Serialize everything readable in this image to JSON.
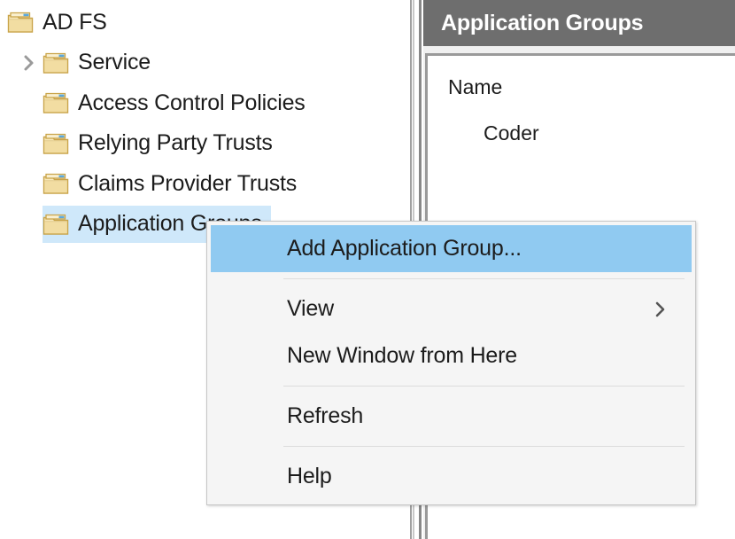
{
  "tree": {
    "items": [
      {
        "label": "AD FS",
        "level": 0,
        "icon": "folder-icon",
        "expander": "none",
        "selected": false
      },
      {
        "label": "Service",
        "level": 1,
        "icon": "folder-icon",
        "expander": "collapsed",
        "selected": false
      },
      {
        "label": "Access Control Policies",
        "level": 1,
        "icon": "folder-icon",
        "expander": "none",
        "selected": false
      },
      {
        "label": "Relying Party Trusts",
        "level": 1,
        "icon": "folder-icon",
        "expander": "none",
        "selected": false
      },
      {
        "label": "Claims Provider Trusts",
        "level": 1,
        "icon": "folder-icon",
        "expander": "none",
        "selected": false
      },
      {
        "label": "Application Groups",
        "level": 1,
        "icon": "folder-icon",
        "expander": "none",
        "selected": true
      }
    ]
  },
  "results": {
    "header_title": "Application Groups",
    "column_header": "Name",
    "rows": [
      {
        "name": "Coder"
      }
    ]
  },
  "context_menu": {
    "items": [
      {
        "label": "Add Application Group...",
        "highlighted": true,
        "submenu": false,
        "separator_after": true
      },
      {
        "label": "View",
        "highlighted": false,
        "submenu": true,
        "separator_after": false
      },
      {
        "label": "New Window from Here",
        "highlighted": false,
        "submenu": false,
        "separator_after": true
      },
      {
        "label": "Refresh",
        "highlighted": false,
        "submenu": false,
        "separator_after": true
      },
      {
        "label": "Help",
        "highlighted": false,
        "submenu": false,
        "separator_after": false
      }
    ]
  },
  "colors": {
    "tree_selection": "#cfe8fa",
    "menu_highlight": "#90caf1",
    "menu_background": "#f5f5f5",
    "results_header_bg": "#6e6e6e",
    "folder_body": "#f3dfa8"
  }
}
